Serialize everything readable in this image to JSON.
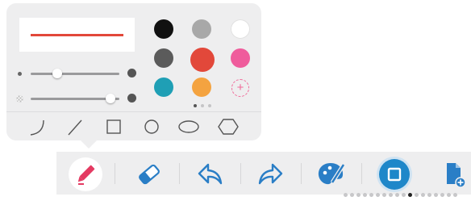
{
  "colors": {
    "panel_bg": "#eeeeef",
    "stroke_preview": "#e2483a",
    "accent_blue": "#1e87c9",
    "icon_blue": "#2a7ec6",
    "pencil_red": "#e43a62"
  },
  "pen_panel": {
    "stroke_preview_color": "#e2483a",
    "thickness_level": 0.3,
    "opacity_level": 0.9,
    "palette": [
      {
        "name": "black",
        "hex": "#111111"
      },
      {
        "name": "light-gray",
        "hex": "#a8a8a8"
      },
      {
        "name": "white",
        "hex": "#ffffff"
      },
      {
        "name": "dark-gray",
        "hex": "#5b5b5b"
      },
      {
        "name": "red-orange",
        "hex": "#e2483a"
      },
      {
        "name": "pink",
        "hex": "#ef5c9c"
      },
      {
        "name": "teal",
        "hex": "#1f9fb5"
      },
      {
        "name": "orange",
        "hex": "#f4a340"
      }
    ],
    "add_color_symbol": "+",
    "palette_page": {
      "current": 1,
      "total": 3
    },
    "shape_tools": [
      "curve-icon",
      "line-icon",
      "square-icon",
      "circle-icon",
      "ellipse-icon",
      "hexagon-icon"
    ]
  },
  "toolbar": {
    "tools": [
      "pencil-icon",
      "eraser-icon",
      "undo-icon",
      "redo-icon",
      "palette-icon",
      "square-tool-icon",
      "add-page-icon"
    ],
    "active_tool": "pencil-icon",
    "page_indicator": {
      "current": 11,
      "total": 18
    }
  }
}
